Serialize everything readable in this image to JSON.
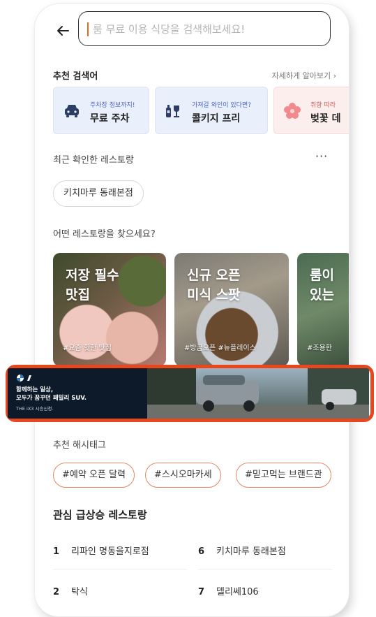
{
  "search": {
    "placeholder": "룸 무료 이용 식당을 검색해보세요!"
  },
  "recommended": {
    "title": "추천 검색어",
    "more": "자세하게 알아보기 ›",
    "cards": [
      {
        "small": "주차장 정보까지!",
        "big": "무료 주차",
        "icon": "car-icon",
        "bg": "#eaf0fb"
      },
      {
        "small": "가져갈 와인이 있다면?",
        "big": "콜키지 프리",
        "icon": "wine-bottle-glass-icon",
        "bg": "#eaf0fb"
      },
      {
        "small": "취향 따라",
        "big": "벚꽃 데",
        "icon": "cherry-blossom-icon",
        "bg": "#fdeeee"
      }
    ]
  },
  "recent": {
    "title": "최근 확인한 레스토랑",
    "menu": "···",
    "chip": "키치마루 동래본점"
  },
  "find": {
    "title": "어떤 레스토랑을 찾으세요?",
    "cards": [
      {
        "title": "저장 필수\n맛집",
        "tag": "#요즘 핫한 맛집"
      },
      {
        "title": "신규 오픈\n미식 스팟",
        "tag": "#방금오픈 #뉴플레이스"
      },
      {
        "title": "룸이\n있는",
        "tag": "#조용한"
      }
    ]
  },
  "banner": {
    "line1": "함께하는 일상,",
    "line2": "모두가 꿈꾸던 패밀리 SUV.",
    "line3": "THE iX3 시승신청."
  },
  "hashtags": {
    "title": "추천 해시태그",
    "items": [
      "#예약 오픈 달력",
      "#스시오마카세",
      "#믿고먹는 브랜드관"
    ]
  },
  "ranking": {
    "title": "관심 급상승 레스토랑",
    "items": [
      {
        "rank": "1",
        "name": "리파인 명동을지로점"
      },
      {
        "rank": "6",
        "name": "키치마루 동래본점"
      },
      {
        "rank": "2",
        "name": "탁식"
      },
      {
        "rank": "7",
        "name": "델리쎄106"
      }
    ]
  },
  "colors": {
    "highlight": "#e6471f",
    "hashtag_border": "#e08a62",
    "accent_blue": "#4a63c8"
  }
}
